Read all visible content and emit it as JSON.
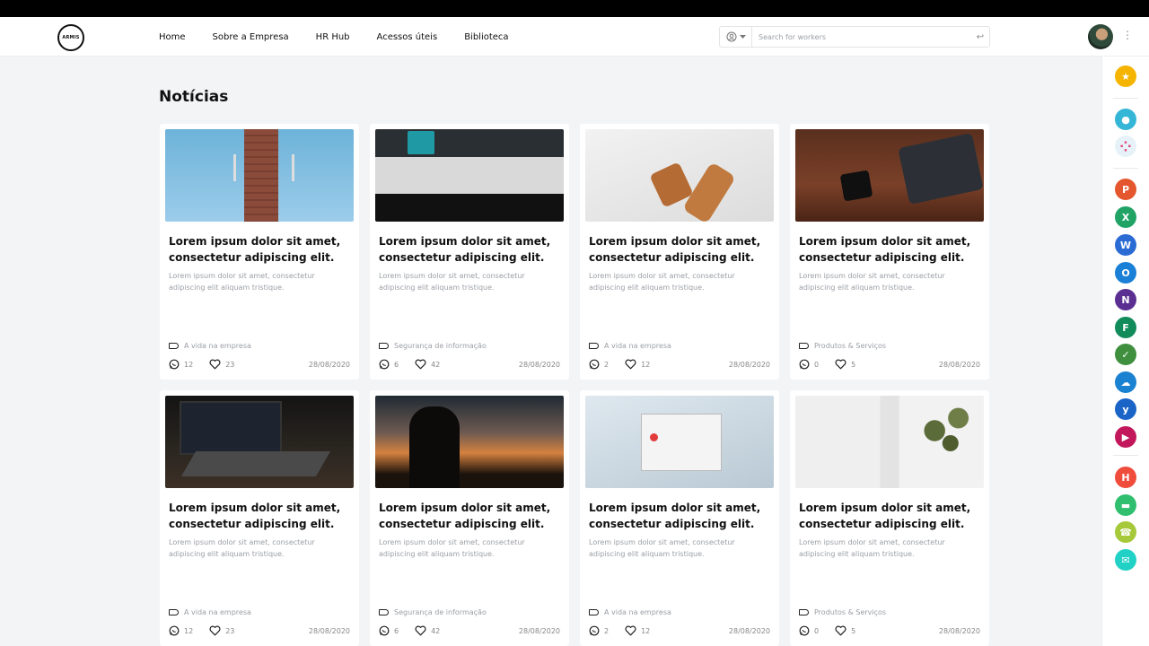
{
  "header": {
    "logo_text": "ARMIS",
    "nav": [
      "Home",
      "Sobre a Empresa",
      "HR Hub",
      "Acessos úteis",
      "Biblioteca"
    ],
    "search_placeholder": "Search for workers"
  },
  "page": {
    "title": "Notícias"
  },
  "cards": [
    {
      "title": "Lorem ipsum dolor sit amet, consectetur adipiscing elit.",
      "desc": "Lorem ipsum dolor sit amet, consectetur adipiscing elit aliquam tristique.",
      "tag": "A vida na empresa",
      "comments": "12",
      "likes": "23",
      "date": "28/08/2020",
      "image": "cell-tower-photo"
    },
    {
      "title": "Lorem ipsum dolor sit amet, consectetur adipiscing elit.",
      "desc": "Lorem ipsum dolor sit amet, consectetur adipiscing elit aliquam tristique.",
      "tag": "Segurança de informação",
      "comments": "6",
      "likes": "42",
      "date": "28/08/2020",
      "image": "imac-photo"
    },
    {
      "title": "Lorem ipsum dolor sit amet, consectetur adipiscing elit.",
      "desc": "Lorem ipsum dolor sit amet, consectetur adipiscing elit aliquam tristique.",
      "tag": "A vida na empresa",
      "comments": "2",
      "likes": "12",
      "date": "28/08/2020",
      "image": "phone-wallet-photo"
    },
    {
      "title": "Lorem ipsum dolor sit amet, consectetur adipiscing elit.",
      "desc": "Lorem ipsum dolor sit amet, consectetur adipiscing elit aliquam tristique.",
      "tag": "Produtos & Serviços",
      "comments": "0",
      "likes": "5",
      "date": "28/08/2020",
      "image": "desk-devices-photo"
    },
    {
      "title": "Lorem ipsum dolor sit amet, consectetur adipiscing elit.",
      "desc": "Lorem ipsum dolor sit amet, consectetur adipiscing elit aliquam tristique.",
      "tag": "A vida na empresa",
      "comments": "12",
      "likes": "23",
      "date": "28/08/2020",
      "image": "laptop-photo"
    },
    {
      "title": "Lorem ipsum dolor sit amet, consectetur adipiscing elit.",
      "desc": "Lorem ipsum dolor sit amet, consectetur adipiscing elit aliquam tristique.",
      "tag": "Segurança de informação",
      "comments": "6",
      "likes": "42",
      "date": "28/08/2020",
      "image": "sunset-photographer-photo"
    },
    {
      "title": "Lorem ipsum dolor sit amet, consectetur adipiscing elit.",
      "desc": "Lorem ipsum dolor sit amet, consectetur adipiscing elit aliquam tristique.",
      "tag": "A vida na empresa",
      "comments": "2",
      "likes": "12",
      "date": "28/08/2020",
      "image": "error-dialog-photo"
    },
    {
      "title": "Lorem ipsum dolor sit amet, consectetur adipiscing elit.",
      "desc": "Lorem ipsum dolor sit amet, consectetur adipiscing elit aliquam tristique.",
      "tag": "Produtos & Serviços",
      "comments": "0",
      "likes": "5",
      "date": "28/08/2020",
      "image": "plant-window-photo"
    }
  ],
  "rail": [
    {
      "name": "favorites-star-icon",
      "color": "#f5b400",
      "glyph": "★"
    },
    {
      "name": "teams-group-icon",
      "color": "#35b6d6",
      "glyph": "●"
    },
    {
      "name": "apps-dots-icon",
      "color": "#e6f2f8",
      "glyph": "⁘"
    },
    {
      "name": "powerpoint-icon",
      "color": "#e4572e",
      "glyph": "P"
    },
    {
      "name": "excel-icon",
      "color": "#21a366",
      "glyph": "X"
    },
    {
      "name": "word-icon",
      "color": "#2b6cd4",
      "glyph": "W"
    },
    {
      "name": "outlook-icon",
      "color": "#1a7fd6",
      "glyph": "O"
    },
    {
      "name": "onenote-icon",
      "color": "#5b2f91",
      "glyph": "N"
    },
    {
      "name": "forms-icon",
      "color": "#118b5a",
      "glyph": "F"
    },
    {
      "name": "teams-people-icon",
      "color": "#3f8f3f",
      "glyph": "✓"
    },
    {
      "name": "onedrive-icon",
      "color": "#1b82d1",
      "glyph": "☁"
    },
    {
      "name": "yammer-icon",
      "color": "#1a64c8",
      "glyph": "y"
    },
    {
      "name": "stream-icon",
      "color": "#c2185b",
      "glyph": "▶"
    },
    {
      "name": "hub-logo-icon",
      "color": "#ef4c3c",
      "glyph": "H"
    },
    {
      "name": "car-icon",
      "color": "#2fbf6e",
      "glyph": "▬"
    },
    {
      "name": "support-headset-icon",
      "color": "#a5c93a",
      "glyph": "☎"
    },
    {
      "name": "chat-icon",
      "color": "#22d1c5",
      "glyph": "✉"
    }
  ]
}
